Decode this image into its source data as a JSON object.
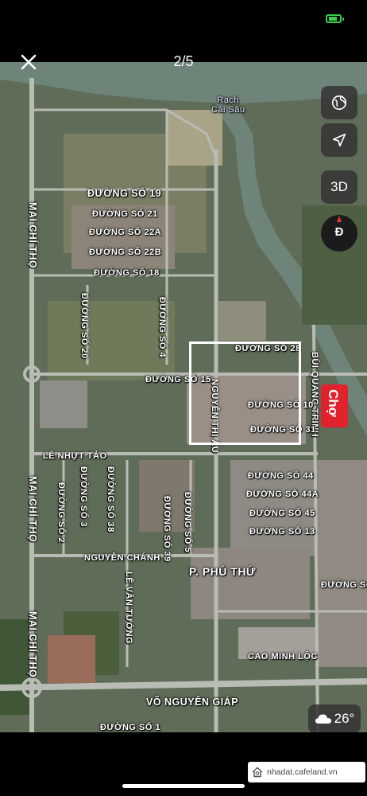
{
  "viewer": {
    "page_counter": "2/5"
  },
  "map": {
    "streets": [
      {
        "id": "street-duong-so-19",
        "text": "ĐƯỜNG SỐ 19"
      },
      {
        "id": "street-duong-so-21",
        "text": "ĐƯỜNG SỐ 21"
      },
      {
        "id": "street-duong-so-22a",
        "text": "ĐƯỜNG SỐ 22A"
      },
      {
        "id": "street-duong-so-22b",
        "text": "ĐƯỜNG SỐ 22B"
      },
      {
        "id": "street-duong-so-18",
        "text": "ĐƯỜNG SỐ 18"
      },
      {
        "id": "street-mai-chi-tho-top",
        "text": "MAI CHÍ THỌ"
      },
      {
        "id": "street-duong-so-20",
        "text": "ĐƯỜNG SỐ 20"
      },
      {
        "id": "street-duong-so-4",
        "text": "ĐƯỜNG SỐ 4"
      },
      {
        "id": "street-duong-so-28",
        "text": "ĐƯỜNG SỐ 28"
      },
      {
        "id": "street-bui-quang-trinh",
        "text": "BÙI QUANG TRINH"
      },
      {
        "id": "street-duong-so-15",
        "text": "ĐƯỜNG SỐ 15"
      },
      {
        "id": "street-nguyen-thi-au",
        "text": "NGUYỄN THỊ ÂU"
      },
      {
        "id": "street-duong-so-10",
        "text": "ĐƯỜNG SỐ 10"
      },
      {
        "id": "street-duong-so-31",
        "text": "ĐƯỜNG SỐ 31"
      },
      {
        "id": "street-le-nhut-tao",
        "text": "LÊ NHỰT TẢO"
      },
      {
        "id": "street-mai-chi-tho-mid",
        "text": "MAI CHÍ THỌ"
      },
      {
        "id": "street-duong-so-2",
        "text": "ĐƯỜNG SỐ 2"
      },
      {
        "id": "street-duong-so-3",
        "text": "ĐƯỜNG SỐ 3"
      },
      {
        "id": "street-duong-so-38",
        "text": "ĐƯỜNG SỐ 38"
      },
      {
        "id": "street-duong-so-39",
        "text": "ĐƯỜNG SỐ 39"
      },
      {
        "id": "street-duong-so-5",
        "text": "ĐƯỜNG SỐ 5"
      },
      {
        "id": "street-duong-so-44",
        "text": "ĐƯỜNG SỐ 44"
      },
      {
        "id": "street-duong-so-44a",
        "text": "ĐƯỜNG SỐ 44A"
      },
      {
        "id": "street-duong-so-45",
        "text": "ĐƯỜNG SỐ 45"
      },
      {
        "id": "street-duong-so-13",
        "text": "ĐƯỜNG SỐ 13"
      },
      {
        "id": "street-nguyen-chanh",
        "text": "NGUYỄN CHÁNH"
      },
      {
        "id": "street-le-van-tuong",
        "text": "LÊ VĂN TƯỞNG"
      },
      {
        "id": "street-duong-so-right",
        "text": "ĐƯỜNG SỐ"
      },
      {
        "id": "street-mai-chi-tho-bottom",
        "text": "MAI CHÍ THỌ"
      },
      {
        "id": "street-cao-minh-loc",
        "text": "CAO MINH LỘC"
      },
      {
        "id": "street-vo-nguyen-giap",
        "text": "VÕ NGUYÊN GIÁP"
      },
      {
        "id": "street-duong-so-1",
        "text": "ĐƯỜNG SỐ 1"
      }
    ],
    "ward_label": "P. PHÚ THỨ",
    "river_label_line1": "Rạch",
    "river_label_line2": "Cái Sâu",
    "market_label": "Chợ",
    "controls": {
      "globe_icon": "globe-icon",
      "location_icon": "location-arrow-icon",
      "view_3d_label": "3D",
      "compass_letter": "Đ"
    },
    "weather": {
      "icon": "cloud-icon",
      "temperature": "26°"
    }
  },
  "watermark": {
    "text": "nhadat.cafeland.vn"
  },
  "colors": {
    "river": "#6f8478",
    "road": "#b9bcb4",
    "battery": "#3ccf4e",
    "market_badge": "#e0222c"
  }
}
